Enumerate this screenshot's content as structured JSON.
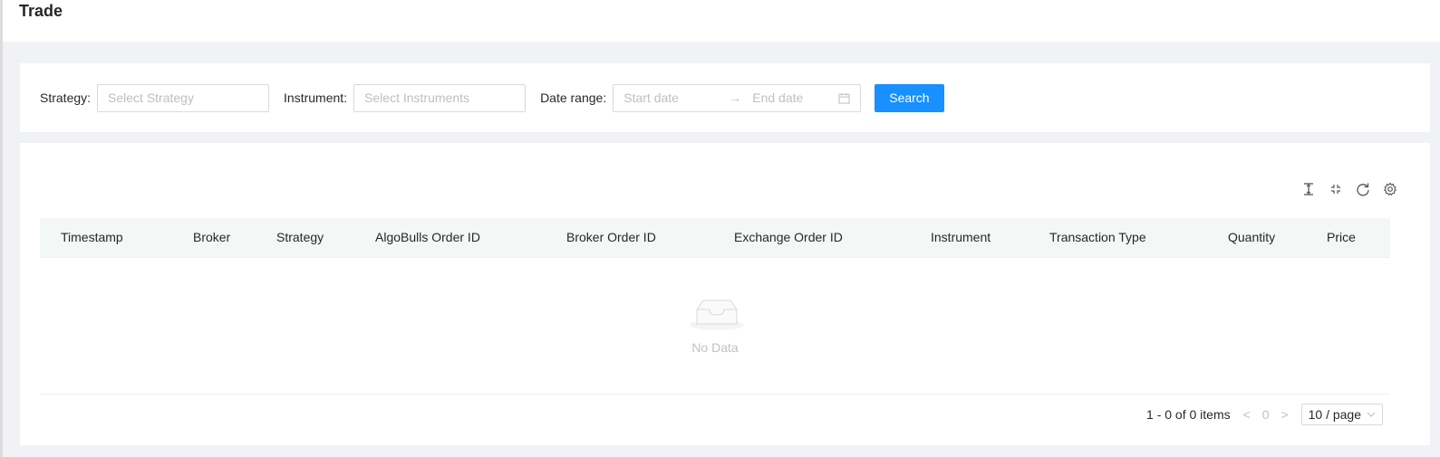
{
  "header": {
    "title": "Trade"
  },
  "filters": {
    "strategy_label": "Strategy",
    "strategy_placeholder": "Select Strategy",
    "instrument_label": "Instrument",
    "instrument_placeholder": "Select Instruments",
    "date_label": "Date range",
    "start_placeholder": "Start date",
    "end_placeholder": "End date",
    "search_button": "Search"
  },
  "toolbar": {
    "icons": [
      "column-height-icon",
      "fullscreen-icon",
      "reload-icon",
      "setting-icon"
    ]
  },
  "table": {
    "columns": [
      "Timestamp",
      "Broker",
      "Strategy",
      "AlgoBulls Order ID",
      "Broker Order ID",
      "Exchange Order ID",
      "Instrument",
      "Transaction Type",
      "Quantity",
      "Price"
    ],
    "empty_text": "No Data"
  },
  "pagination": {
    "total_text": "1 - 0 of 0 items",
    "current_page": "0",
    "page_size": "10 / page"
  },
  "colors": {
    "primary": "#1890ff",
    "header_bg": "#f3f7f5",
    "page_bg": "#f0f2f5"
  }
}
